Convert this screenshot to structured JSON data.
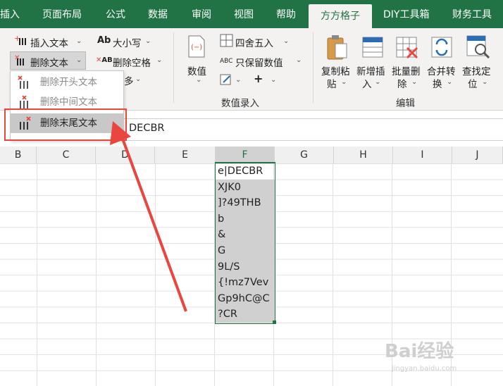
{
  "tabs": [
    {
      "label": "插入",
      "active": false
    },
    {
      "label": "页面布局",
      "active": false
    },
    {
      "label": "公式",
      "active": false
    },
    {
      "label": "数据",
      "active": false
    },
    {
      "label": "审阅",
      "active": false
    },
    {
      "label": "视图",
      "active": false
    },
    {
      "label": "帮助",
      "active": false
    },
    {
      "label": "方方格子",
      "active": true
    },
    {
      "label": "DIY工具箱",
      "active": false
    },
    {
      "label": "财务工具",
      "active": false
    }
  ],
  "ribbon": {
    "text_group": {
      "insert_text": "插入文本",
      "delete_text": "删除文本",
      "case": "大小写",
      "delete_spaces": "删除空格",
      "more": "多"
    },
    "number_group": {
      "number_button": "数值",
      "round": "四舍五入",
      "keep_numbers": "只保留数值",
      "label": "数值录入"
    },
    "edit_group": {
      "copy_paste_line1": "复制粘",
      "copy_paste_line2": "贴",
      "add_insert_line1": "新增插",
      "add_insert_line2": "入",
      "batch_delete_line1": "批量删",
      "batch_delete_line2": "除",
      "merge_convert_line1": "合并转",
      "merge_convert_line2": "换",
      "find_locate_line1": "查找定",
      "find_locate_line2": "位",
      "label": "编辑"
    }
  },
  "dropdown": {
    "items": [
      "删除开头文本",
      "删除中间文本",
      "删除末尾文本"
    ],
    "highlighted": 2
  },
  "formula_bar": {
    "value": "DECBR"
  },
  "columns": [
    "B",
    "C",
    "D",
    "E",
    "F",
    "G",
    "H",
    "I",
    "J"
  ],
  "selected_column": "F",
  "cells_F": [
    "e|DECBR",
    "XJK0",
    "]?49THB",
    "b",
    "&",
    "G",
    "9L/S",
    "{!mz7Vev",
    "Gp9hC@C",
    "?CR"
  ],
  "colors": {
    "excel_green": "#217346",
    "callout_red": "#e8463f"
  },
  "watermark": {
    "brand": "Bai经验",
    "url": "jingyan.baidu.com"
  }
}
